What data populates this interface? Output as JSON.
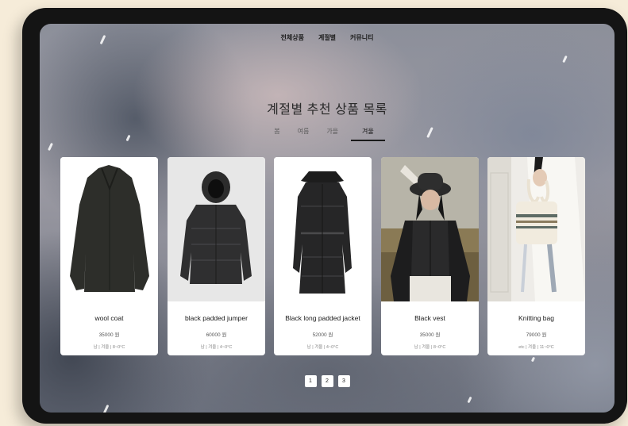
{
  "nav": {
    "items": [
      "전체상품",
      "계절별",
      "커뮤니티"
    ]
  },
  "page": {
    "title": "계절별 추천 상품 목록"
  },
  "season_tabs": {
    "items": [
      "봄",
      "여름",
      "가을",
      "겨울"
    ],
    "active": "겨울"
  },
  "products": [
    {
      "name": "wool coat",
      "price": "35000 원",
      "meta": "남 | 겨울 | 8~0°C",
      "image": "wool-coat-image"
    },
    {
      "name": "black padded jumper",
      "price": "60000 원",
      "meta": "남 | 겨울 | 4~0°C",
      "image": "padded-jumper-image"
    },
    {
      "name": "Black long padded jacket",
      "price": "52000 원",
      "meta": "남 | 겨울 | 4~0°C",
      "image": "long-padded-jacket-image"
    },
    {
      "name": "Black vest",
      "price": "35000 원",
      "meta": "남 | 겨울 | 8~0°C",
      "image": "vest-model-image"
    },
    {
      "name": "Knitting bag",
      "price": "79000 원",
      "meta": "etc | 겨울 | 11~0°C",
      "image": "knitting-bag-image"
    }
  ],
  "pagination": {
    "pages": [
      "1",
      "2",
      "3"
    ]
  },
  "colors": {
    "frame": "#141414",
    "backdrop": "#f6ecd9",
    "card": "#ffffff",
    "accent": "#1a1a1a"
  }
}
